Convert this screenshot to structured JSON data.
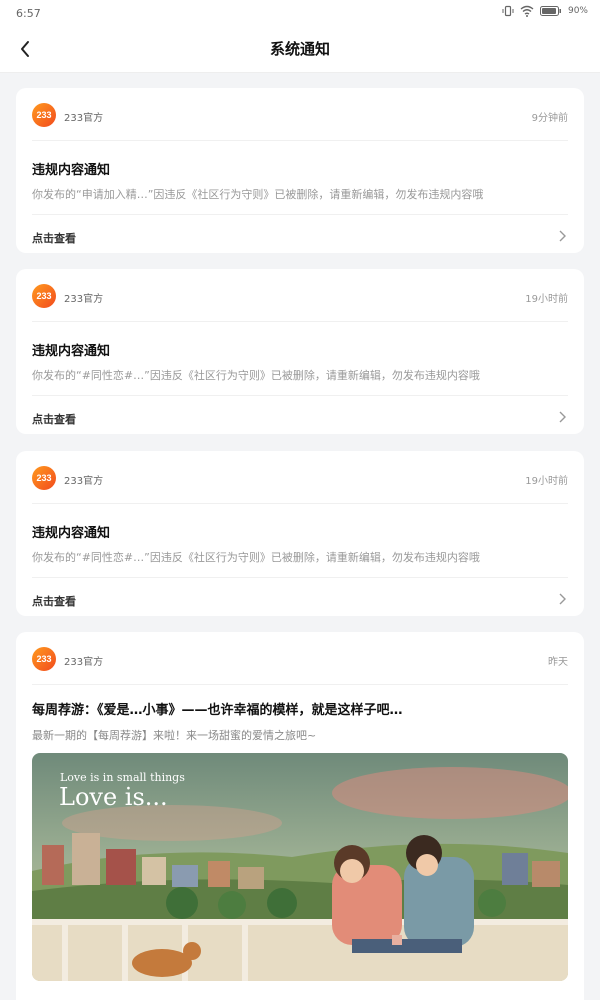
{
  "status_bar": {
    "time": "6:57",
    "battery": "90%"
  },
  "header": {
    "title": "系统通知"
  },
  "notifications": [
    {
      "sender": "233官方",
      "time": "9分钟前",
      "title": "违规内容通知",
      "body": "你发布的“申请加入精…”因违反《社区行为守则》已被删除，请重新编辑，勿发布违规内容哦",
      "action": "点击查看"
    },
    {
      "sender": "233官方",
      "time": "19小时前",
      "title": "违规内容通知",
      "body": "你发布的“#同性恋#…”因违反《社区行为守则》已被删除，请重新编辑，勿发布违规内容哦",
      "action": "点击查看"
    },
    {
      "sender": "233官方",
      "time": "19小时前",
      "title": "违规内容通知",
      "body": "你发布的“#同性恋#…”因违反《社区行为守则》已被删除，请重新编辑，勿发布违规内容哦",
      "action": "点击查看"
    }
  ],
  "article": {
    "sender": "233官方",
    "time": "昨天",
    "title": "每周荐游：《爱是…小事》——也许幸福的模样，就是这样子吧…",
    "subtitle": "最新一期的【每周荐游】来啦！来一场甜蜜的爱情之旅吧~",
    "cover_caption_small": "Love is in small things",
    "cover_caption_large": "Love is..."
  },
  "logo_text": "233",
  "colors": {
    "brand_gradient_start": "#ff9a1f",
    "brand_gradient_end": "#f24a1d"
  },
  "icons": [
    "vibrate-icon",
    "wifi-icon",
    "battery-icon",
    "back-arrow-icon",
    "chevron-right-icon"
  ]
}
